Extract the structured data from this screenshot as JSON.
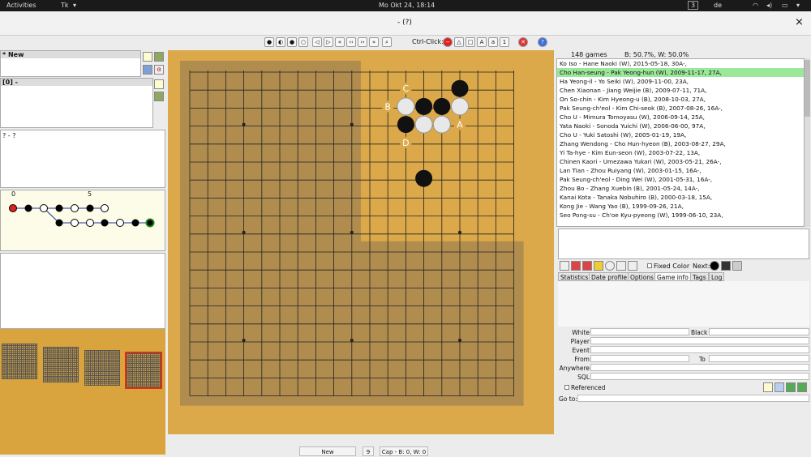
{
  "topbar": {
    "activities": "Activities",
    "app": "Tk",
    "clock": "Mo Okt 24, 18:14",
    "workspace": "3",
    "lang": "de"
  },
  "window": {
    "title": "- (?)",
    "close": "×"
  },
  "toolbar": {
    "ctrl_click_label": "Ctrl-Click:",
    "tools": [
      "A",
      "a",
      "1"
    ]
  },
  "left": {
    "new_label": "* New",
    "node_label": "[0] -",
    "players": "? - ?",
    "tree_axis": [
      "0",
      "5"
    ]
  },
  "board": {
    "size": 19,
    "black_stones": [
      [
        15,
        1
      ],
      [
        13,
        2
      ],
      [
        14,
        2
      ],
      [
        12,
        3
      ],
      [
        13,
        6
      ]
    ],
    "white_stones": [
      [
        12,
        2
      ],
      [
        15,
        2
      ],
      [
        13,
        3
      ],
      [
        14,
        3
      ]
    ],
    "labels": [
      {
        "text": "C",
        "col": 12,
        "row": 1
      },
      {
        "text": "B",
        "col": 11,
        "row": 2
      },
      {
        "text": "A",
        "col": 15,
        "row": 3
      },
      {
        "text": "D",
        "col": 12,
        "row": 4
      }
    ]
  },
  "right": {
    "stats": {
      "games": "148 games",
      "ratio": "B: 50.7%, W: 50.0%"
    },
    "games": [
      "Ko Iso - Hane Naoki (W), 2015-05-18, 30A-,",
      "Cho Han-seung - Pak Yeong-hun (W), 2009-11-17, 27A,",
      "Ha Yeong-il - Yo Seiki (W), 2009-11-00, 23A,",
      "Chen Xiaonan - Jiang Weijie (B), 2009-07-11, 71A,",
      "On So-chin - Kim Hyeong-u (B), 2008-10-03, 27A,",
      "Pak Seung-ch'eol - Kim Chi-seok (B), 2007-08-26, 16A-,",
      "Cho U - Mimura Tomoyasu (W), 2006-09-14, 25A,",
      "Yata Naoki - Sonoda Yuichi (W), 2006-06-00, 97A,",
      "Cho U - Yuki Satoshi (W), 2005-01-19, 19A,",
      "Zhang Wendong - Cho Hun-hyeon (B), 2003-08-27, 29A,",
      "Yi Ta-hye - Kim Eun-seon (W), 2003-07-22, 13A,",
      "Chinen Kaori - Umezawa Yukari (W), 2003-05-21, 26A-,",
      "Lan Tian - Zhou Ruiyang (W), 2003-01-15, 16A-,",
      "Pak Seung-ch'eol - Ding Wei (W), 2001-05-31, 16A-,",
      "Zhou Bo - Zhang Xuebin (B), 2001-05-24, 14A-,",
      "Kanai Kota - Tanaka Nobuhiro (B), 2000-03-18, 15A,",
      "Kong Jie - Wang Yao (B), 1999-09-26, 21A,",
      "Seo Pong-su - Ch'oe Kyu-pyeong (W), 1999-06-10, 23A,"
    ],
    "selected_index": 1,
    "fixed_color": "Fixed Color",
    "next_label": "Next:",
    "tabs": [
      "Statistics",
      "Date profile",
      "Options",
      "Game info",
      "Tags",
      "Log"
    ],
    "active_tab": 3,
    "search": {
      "white": "White",
      "black": "Black",
      "player": "Player",
      "event": "Event",
      "from": "From",
      "to": "To",
      "anywhere": "Anywhere",
      "sql": "SQL",
      "referenced": "Referenced",
      "goto": "Go to:"
    }
  },
  "status": {
    "mode": "New",
    "move": "9",
    "captures": "Cap - B: 0, W: 0"
  }
}
